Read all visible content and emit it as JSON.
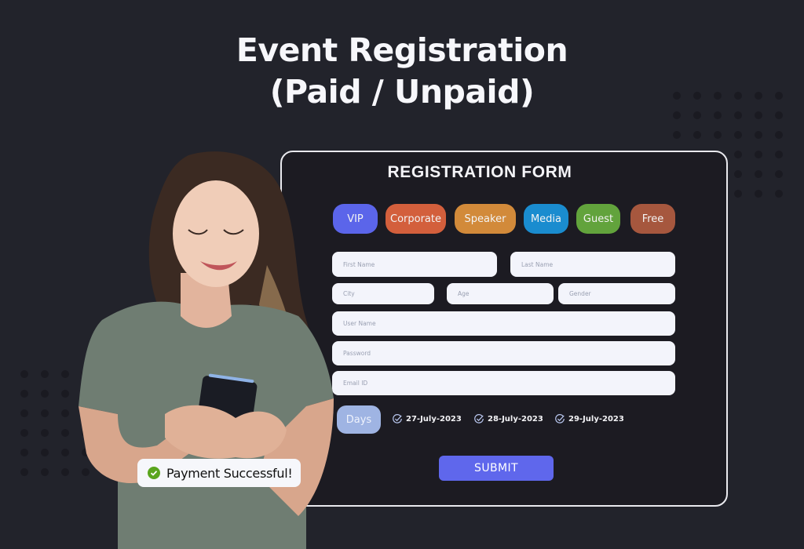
{
  "headline": {
    "line1": "Event Registration",
    "line2": "(Paid / Unpaid)"
  },
  "form": {
    "title": "REGISTRATION FORM",
    "categories": [
      {
        "label": "VIP",
        "color": "#5b65ea"
      },
      {
        "label": "Corporate",
        "color": "#d35f3c"
      },
      {
        "label": "Speaker",
        "color": "#d28a3a"
      },
      {
        "label": "Media",
        "color": "#1a8ccf"
      },
      {
        "label": "Guest",
        "color": "#62a33c"
      },
      {
        "label": "Free",
        "color": "#a6573e"
      }
    ],
    "fields": {
      "first_name": "First Name",
      "last_name": "Last Name",
      "city": "City",
      "age": "Age",
      "gender": "Gender",
      "user_name": "User Name",
      "password": "Password",
      "email": "Email ID"
    },
    "days_label": "Days",
    "days": [
      "27-July-2023",
      "28-July-2023",
      "29-July-2023"
    ],
    "submit_label": "SUBMIT"
  },
  "toast": {
    "message": "Payment Successful!",
    "icon": "check-circle-icon",
    "color": "#5aa51d"
  },
  "colors": {
    "background": "#22232b",
    "card": "#1c1b22",
    "accent": "#5f67ec"
  }
}
